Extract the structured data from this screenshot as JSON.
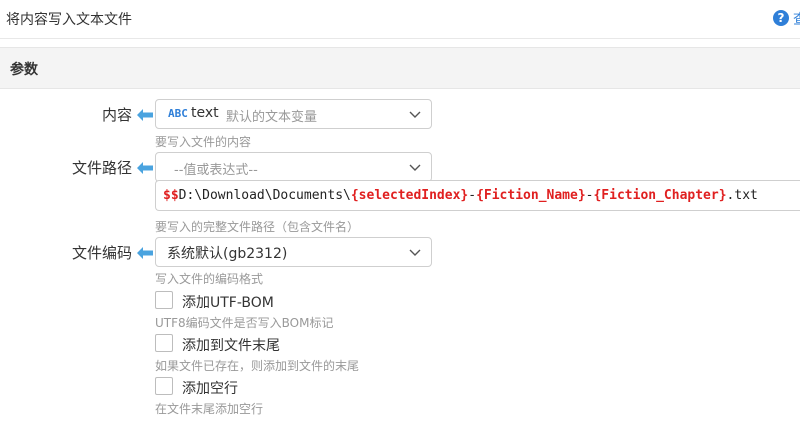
{
  "header": {
    "title": "将内容写入文本文件",
    "help_glyph": "?",
    "help_label": "查"
  },
  "section": {
    "title": "参数"
  },
  "fields": {
    "content": {
      "label": "内容",
      "type_icon": "ABC",
      "var_name": "text",
      "var_desc": "默认的文本变量",
      "hint": "要写入文件的内容"
    },
    "path": {
      "label": "文件路径",
      "placeholder": "--值或表达式--",
      "value_parts": [
        {
          "text": "$$",
          "red": true
        },
        {
          "text": "D:\\Download\\Documents\\",
          "red": false
        },
        {
          "text": "{selectedIndex}",
          "red": true
        },
        {
          "text": "-",
          "red": false
        },
        {
          "text": "{Fiction_Name}",
          "red": true
        },
        {
          "text": "-",
          "red": false
        },
        {
          "text": "{Fiction_Chapter}",
          "red": true
        },
        {
          "text": ".txt",
          "red": false
        }
      ],
      "hint": "要写入的完整文件路径（包含文件名）"
    },
    "encoding": {
      "label": "文件编码",
      "value": "系统默认(gb2312)",
      "hint": "写入文件的编码格式"
    }
  },
  "options": [
    {
      "label": "添加UTF-BOM",
      "hint": "UTF8编码文件是否写入BOM标记",
      "checked": false
    },
    {
      "label": "添加到文件末尾",
      "hint": "如果文件已存在，则添加到文件的末尾",
      "checked": false
    },
    {
      "label": "添加空行",
      "hint": "在文件末尾添加空行",
      "checked": false
    }
  ],
  "colors": {
    "accent": "#2f7fd8",
    "arrow": "#4aa3df",
    "variable_red": "#e02020",
    "hint": "#999999"
  }
}
